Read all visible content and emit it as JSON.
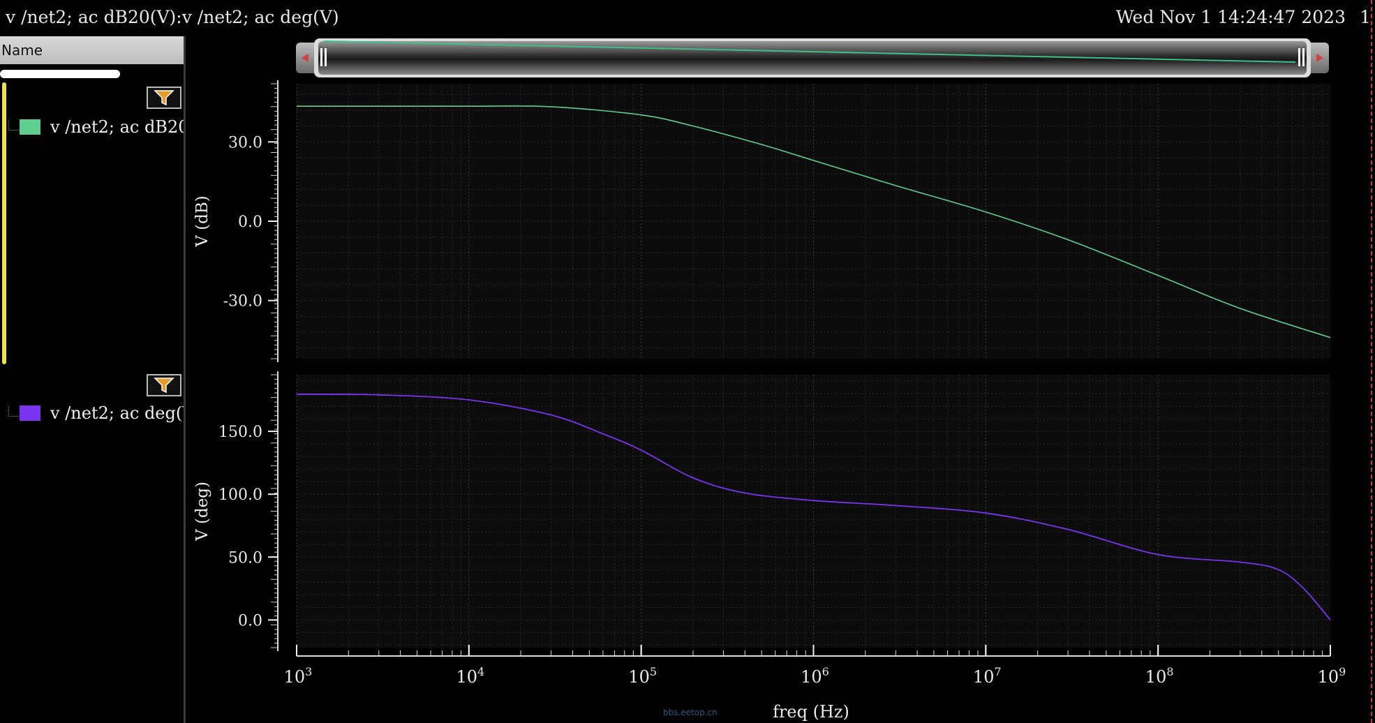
{
  "header": {
    "title": "v /net2; ac dB20(V):v /net2; ac deg(V)",
    "date": "Wed Nov 1 14:24:47 2023",
    "edge_char": "1"
  },
  "sidebar": {
    "column_header": "Name",
    "traces": [
      {
        "label": "v /net2; ac dB20",
        "color": "#5ecf8e"
      },
      {
        "label": "v /net2; ac deg(V",
        "color": "#7a33f0"
      }
    ]
  },
  "watermark": "bbs.eetop.cn",
  "chart_data": [
    {
      "type": "line",
      "ylabel": "V (dB)",
      "xlabel": "freq (Hz)",
      "xscale": "log",
      "xlim": [
        1000,
        1000000000
      ],
      "ylim": [
        -52,
        52
      ],
      "yticks": [
        -30,
        0,
        30
      ],
      "ytick_labels": [
        "-30.0",
        "0.0",
        "30.0"
      ],
      "grid": true,
      "series": [
        {
          "name": "v /net2; ac dB20",
          "color": "#5ecf8e",
          "x": [
            1000,
            10000,
            30000,
            100000,
            200000,
            500000,
            1000000,
            3000000,
            10000000,
            30000000,
            100000000,
            300000000,
            1000000000
          ],
          "y": [
            43.5,
            43.5,
            43.3,
            40.2,
            36.0,
            29.0,
            23.0,
            13.5,
            3.5,
            -7.0,
            -20.5,
            -33.0,
            -44.0
          ]
        }
      ]
    },
    {
      "type": "line",
      "ylabel": "V (deg)",
      "xlabel": "freq (Hz)",
      "xscale": "log",
      "xlim": [
        1000,
        1000000000
      ],
      "ylim": [
        -22,
        195
      ],
      "yticks": [
        0,
        50,
        100,
        150
      ],
      "ytick_labels": [
        "0.0",
        "50.0",
        "100.0",
        "150.0"
      ],
      "xticks": [
        1000,
        10000,
        100000,
        1000000,
        10000000,
        100000000,
        1000000000
      ],
      "xtick_labels": [
        "3",
        "4",
        "5",
        "6",
        "7",
        "8",
        "9"
      ],
      "xtick_base": "10",
      "grid": true,
      "series": [
        {
          "name": "v /net2; ac deg(V",
          "color": "#7a33f0",
          "x": [
            1000,
            3000,
            10000,
            30000,
            60000,
            100000,
            200000,
            400000,
            1000000,
            3000000,
            10000000,
            30000000,
            100000000,
            300000000,
            500000000,
            700000000,
            1000000000
          ],
          "y": [
            179.5,
            179,
            175,
            163,
            148,
            135,
            113,
            101,
            95,
            91,
            85,
            72,
            52,
            46,
            40,
            25,
            0
          ]
        }
      ]
    }
  ]
}
